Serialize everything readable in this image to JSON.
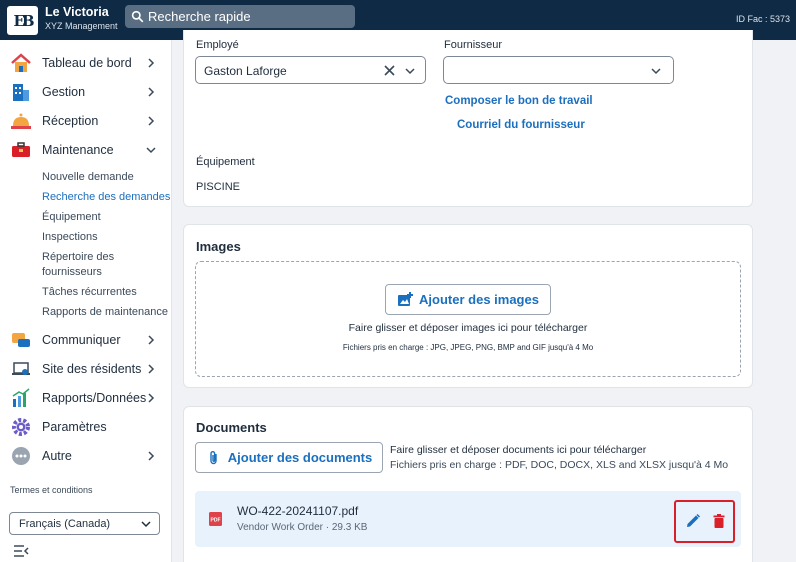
{
  "header": {
    "brand_name": "Le Victoria",
    "brand_sub": "XYZ Management",
    "search_placeholder": "Recherche rapide",
    "id_fac": "ID Fac : 5373",
    "logo_text": "EB"
  },
  "sidebar": {
    "items": [
      {
        "label": "Tableau de bord",
        "icon": "house-icon"
      },
      {
        "label": "Gestion",
        "icon": "building-icon"
      },
      {
        "label": "Réception",
        "icon": "bell-icon"
      },
      {
        "label": "Maintenance",
        "icon": "toolbox-icon"
      },
      {
        "label": "Communiquer",
        "icon": "chat-icon"
      },
      {
        "label": "Site des résidents",
        "icon": "laptop-icon"
      },
      {
        "label": "Rapports/Données",
        "icon": "chart-icon"
      },
      {
        "label": "Paramètres",
        "icon": "gear-icon"
      },
      {
        "label": "Autre",
        "icon": "more-icon"
      }
    ],
    "maintenance_sub": [
      "Nouvelle demande",
      "Recherche des demandes",
      "Équipement",
      "Inspections",
      "Répertoire des fournisseurs",
      "Tâches récurrentes",
      "Rapports de maintenance"
    ],
    "active_sub": "Recherche des demandes",
    "terms": "Termes et conditions",
    "language": "Français (Canada)"
  },
  "form": {
    "employee_label": "Employé",
    "employee_value": "Gaston Laforge",
    "supplier_label": "Fournisseur",
    "supplier_value": "",
    "compose_link": "Composer le bon de travail",
    "email_link": "Courriel du fournisseur",
    "equipment_label": "Équipement",
    "equipment_value": "PISCINE"
  },
  "images": {
    "title": "Images",
    "add_button": "Ajouter des images",
    "drop_hint": "Faire glisser et déposer images ici pour télécharger",
    "formats_hint": "Fichiers pris en charge : JPG, JPEG, PNG, BMP and GIF jusqu'à 4 Mo"
  },
  "documents": {
    "title": "Documents",
    "add_button": "Ajouter des documents",
    "drop_hint": "Faire glisser et déposer documents ici pour télécharger",
    "formats_hint": "Fichiers pris en charge : PDF, DOC, DOCX, XLS and XLSX jusqu'à 4 Mo",
    "files": [
      {
        "name": "WO-422-20241107.pdf",
        "meta": "Vendor Work Order · 29.3 KB",
        "icon_label": "PDF"
      }
    ]
  },
  "colors": {
    "topbar": "#0f2a44",
    "link": "#1b6fbf",
    "delete": "#d9202a",
    "highlight_box": "#d9202a",
    "doc_row": "#e8f2fc"
  }
}
